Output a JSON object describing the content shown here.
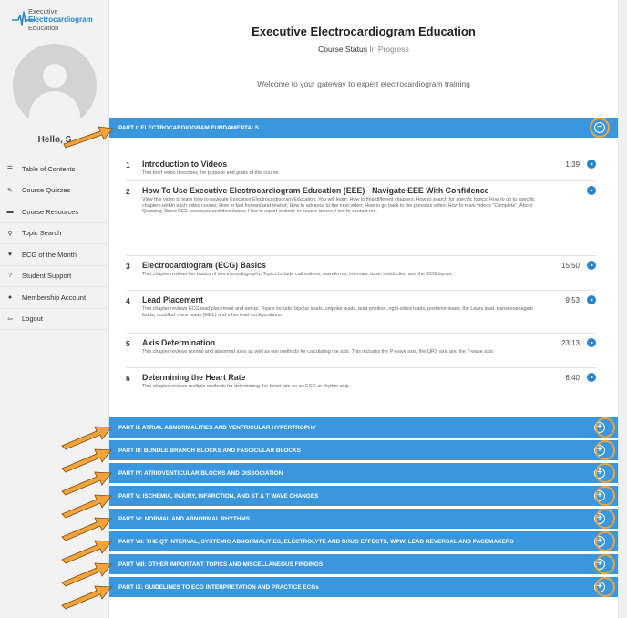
{
  "logo": {
    "line1": "Executive",
    "line2": "Electrocardiogram",
    "line3": "Education"
  },
  "user": {
    "greeting": "Hello, S"
  },
  "nav": [
    {
      "icon": "list-icon",
      "glyph": "☰",
      "label": "Table of Contents"
    },
    {
      "icon": "quiz-icon",
      "glyph": "✎",
      "label": "Course Quizzes"
    },
    {
      "icon": "folder-icon",
      "glyph": "▬",
      "label": "Course Resources"
    },
    {
      "icon": "search-icon",
      "glyph": "⚲",
      "label": "Topic Search"
    },
    {
      "icon": "heartbeat-icon",
      "glyph": "♥",
      "label": "ECG of the Month"
    },
    {
      "icon": "support-icon",
      "glyph": "?",
      "label": "Student Support"
    },
    {
      "icon": "user-icon",
      "glyph": "●",
      "label": "Membership Account"
    },
    {
      "icon": "logout-icon",
      "glyph": "⇦",
      "label": "Logout"
    }
  ],
  "main": {
    "title": "Executive Electrocardiogram Education",
    "status_label": "Course Status",
    "status_value": "In Progress",
    "welcome": "Welcome to your gateway to expert electrocardiogram training"
  },
  "parts": [
    {
      "label": "PART I: ELECTROCARDIOGRAM FUNDAMENTALS",
      "toggle": "−",
      "expanded": true
    },
    {
      "label": "PART II: ATRIAL ABNORMALITIES AND VENTRICULAR HYPERTROPHY",
      "toggle": "+"
    },
    {
      "label": "PART III: BUNDLE BRANCH BLOCKS AND FASCICULAR BLOCKS",
      "toggle": "+"
    },
    {
      "label": "PART IV: ATRIOVENTICULAR BLOCKS AND DISSOCIATION",
      "toggle": "+"
    },
    {
      "label": "PART V: ISCHEMIA, INJURY, INFARCTION, AND ST & T WAVE CHANGES",
      "toggle": "+"
    },
    {
      "label": "PART VI: NORMAL AND ABNORMAL RHYTHMS",
      "toggle": "+"
    },
    {
      "label": "PART VII: THE QT INTERVAL, SYSTEMIC ABNORMALITIES, ELECTROLYTE AND DRUG EFFECTS, WPW, LEAD REVERSAL AND PACEMAKERS",
      "toggle": "+"
    },
    {
      "label": "PART VIII: OTHER IMPORTANT TOPICS AND MISCELLANEOUS FINDINGS",
      "toggle": "+"
    },
    {
      "label": "PART IX: GUIDELINES TO ECG INTERPRETATION AND PRACTICE ECGs",
      "toggle": "+"
    }
  ],
  "chapters": [
    {
      "num": "1",
      "title": "Introduction to Videos",
      "desc": "This brief video describes the purpose and goals of this course.",
      "duration": "1:39"
    },
    {
      "num": "2",
      "title": "How To Use Executive Electrocardiogram Education (EEE) - Navigate EEE With Confidence",
      "desc": "View this video to learn how to navigate Executive Electrocardiogram Education. You will learn: How to find different chapters; How to search for specific topics; How to go to specific chapters within each video course; How to fast forward and rewind; How to advance to the next video; How to go back to the previous video; How to mark videos \"Complete\"; About Quizzing; About EEE resources and downloads; How to report website or course issues; How to contact me.",
      "duration": ""
    },
    {
      "num": "3",
      "title": "Electrocardiogram (ECG) Basics",
      "desc": "This chapter reviews the basics of electrocardiography. Topics include calibrations, waveforms, intervals, basic conduction and the ECG layout.",
      "duration": "15:50"
    },
    {
      "num": "4",
      "title": "Lead Placement",
      "desc": "This chapter reviews ECG lead placement and set up. Topics include: bipolar leads, unipolar leads, lead position, right-sided leads, posterior leads, the Lewis lead, transesophageal leads, modified chest leads (MCL) and other lead configurations.",
      "duration": "9:53"
    },
    {
      "num": "5",
      "title": "Axis Determination",
      "desc": "This chapter reviews normal and abnormal axes as well as two methods for calculating the axis. This includes the P-wave axis, the QRS axis and the T-wave axis.",
      "duration": "23:13"
    },
    {
      "num": "6",
      "title": "Determining the Heart Rate",
      "desc": "This chapter reviews multiple methods for determining the heart rate on an ECG or rhythm strip.",
      "duration": "6:40"
    }
  ],
  "colors": {
    "accent": "#3a97de",
    "highlight": "#f2a33a"
  }
}
